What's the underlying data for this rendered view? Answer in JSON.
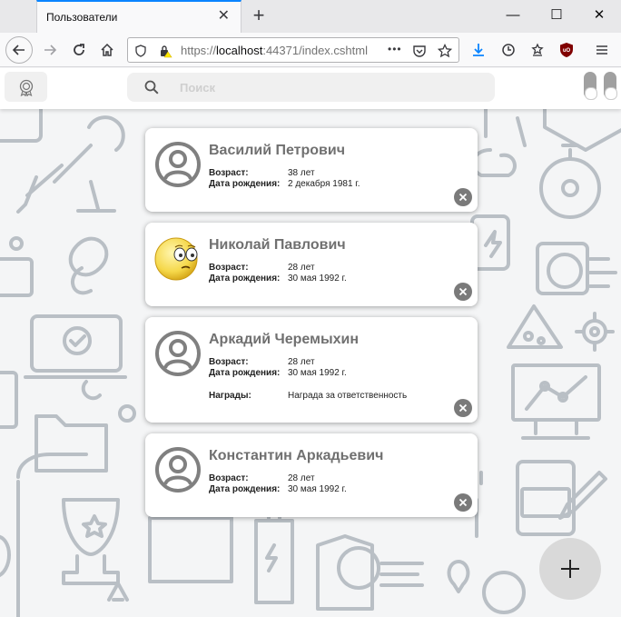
{
  "browser": {
    "tab_title": "Пользователи",
    "tab_close": "✕",
    "new_tab": "+",
    "window_controls": {
      "minimize": "—",
      "maximize": "☐",
      "close": "✕"
    },
    "url_prefix": "https://",
    "url_host": "localhost",
    "url_rest": ":44371/index.cshtml",
    "more_actions": "•••"
  },
  "header": {
    "search_placeholder": "Поиск",
    "search_value": ""
  },
  "users": [
    {
      "name": "Василий Петрович",
      "avatar": "default-user-icon",
      "age_label": "Возраст:",
      "age": "38 лет",
      "birth_label": "Дата рождения:",
      "birth": "2 декабря 1981 г."
    },
    {
      "name": "Николай Павлович",
      "avatar": "emoji-avatar",
      "age_label": "Возраст:",
      "age": "28 лет",
      "birth_label": "Дата рождения:",
      "birth": "30 мая 1992 г."
    },
    {
      "name": "Аркадий Черемыхин",
      "avatar": "default-user-icon",
      "age_label": "Возраст:",
      "age": "28 лет",
      "birth_label": "Дата рождения:",
      "birth": "30 мая 1992 г.",
      "awards_label": "Награды:",
      "awards": "Награда за ответственность"
    },
    {
      "name": "Константин Аркадьевич",
      "avatar": "default-user-icon",
      "age_label": "Возраст:",
      "age": "28 лет",
      "birth_label": "Дата рождения:",
      "birth": "30 мая 1992 г."
    }
  ],
  "colors": {
    "accent_tab": "#0a84ff",
    "card_name": "#707070",
    "delete_button": "#7a7a7a",
    "fab": "#d9d9d9",
    "background_pattern": "#b9bfc5"
  },
  "icons": {
    "badge": "award-badge-icon",
    "search": "search-icon",
    "delete": "close-circle-icon",
    "fab": "plus-icon"
  }
}
